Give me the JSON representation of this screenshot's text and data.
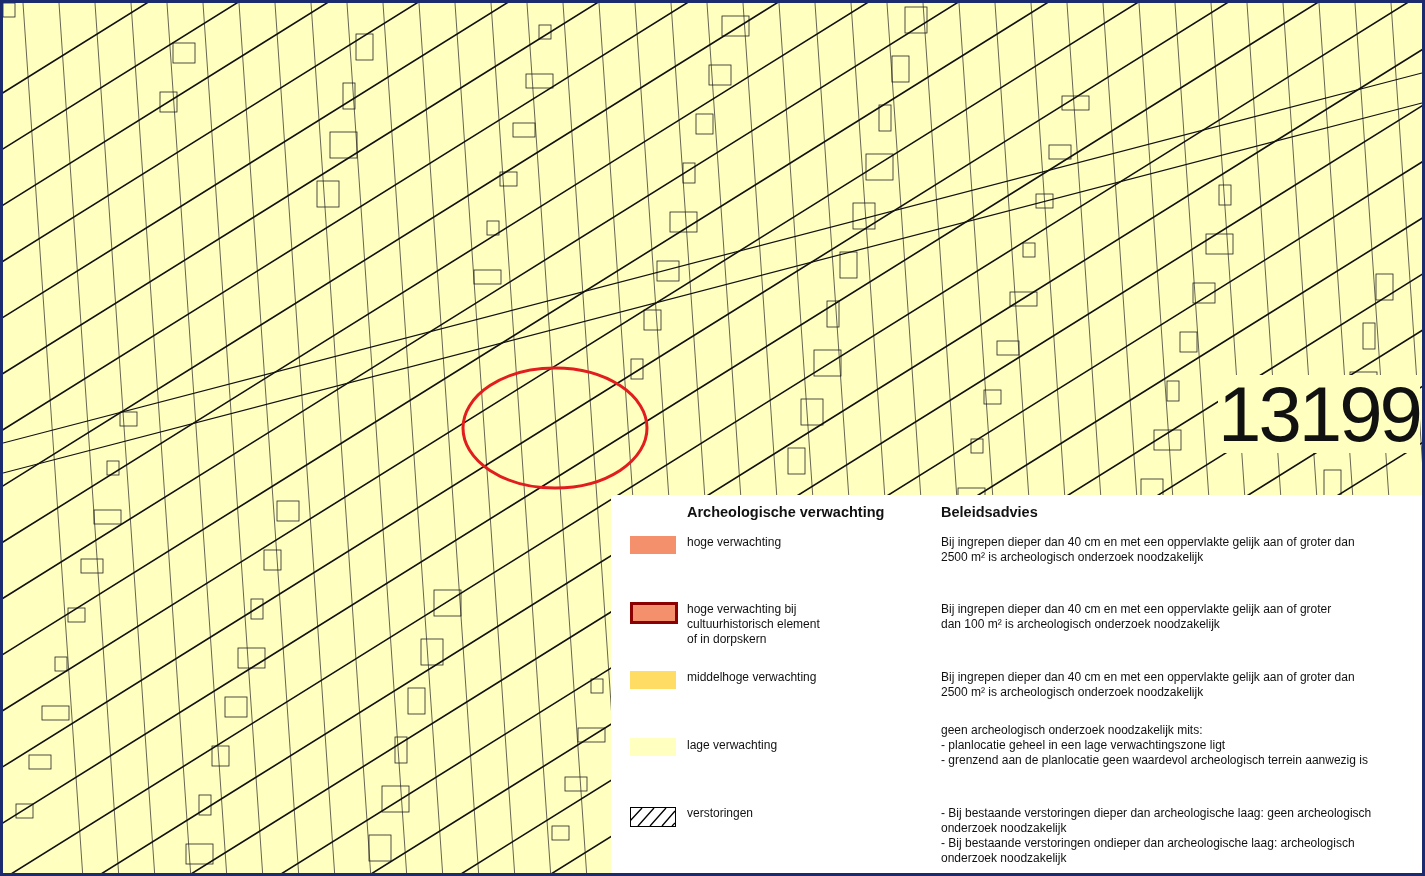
{
  "map": {
    "sheet_number": "13199"
  },
  "legend": {
    "headers": [
      "Archeologische verwachting",
      "Beleidsadvies"
    ],
    "entries": [
      {
        "kind": "fill",
        "color": "#f4906c",
        "label": [
          "hoge verwachting"
        ],
        "advice": [
          "Bij ingrepen dieper dan 40 cm en met een oppervlakte gelijk aan of groter dan",
          "2500 m² is archeologisch onderzoek noodzakelijk"
        ]
      },
      {
        "kind": "outlined",
        "color": "#f4906c",
        "label": [
          "hoge verwachting bij",
          "cultuurhistorisch element",
          "of in dorpskern"
        ],
        "advice": [
          "Bij ingrepen dieper dan 40 cm en met een oppervlakte gelijk aan of groter",
          "dan 100 m² is archeologisch onderzoek noodzakelijk"
        ]
      },
      {
        "kind": "fill",
        "color": "#ffdc64",
        "label": [
          "middelhoge verwachting"
        ],
        "advice": [
          "Bij ingrepen dieper dan 40 cm en met een oppervlakte gelijk aan of groter dan",
          "2500 m² is archeologisch onderzoek noodzakelijk"
        ]
      },
      {
        "kind": "fill",
        "color": "#ffffc0",
        "label": [
          "lage verwachting"
        ],
        "advice": [
          "geen archeologisch onderzoek noodzakelijk mits:",
          "- planlocatie geheel in een lage verwachtingszone ligt",
          "- grenzend aan de planlocatie geen waardevol archeologisch terrein aanwezig is"
        ]
      },
      {
        "kind": "hatched",
        "label": [
          "verstoringen"
        ],
        "advice": [
          "- Bij bestaande verstoringen dieper dan archeologische laag: geen archeologisch",
          "onderzoek noodzakelijk",
          "- Bij bestaande verstoringen ondieper dan archeologische laag: archeologisch",
          "onderzoek noodzakelijk"
        ]
      }
    ]
  }
}
